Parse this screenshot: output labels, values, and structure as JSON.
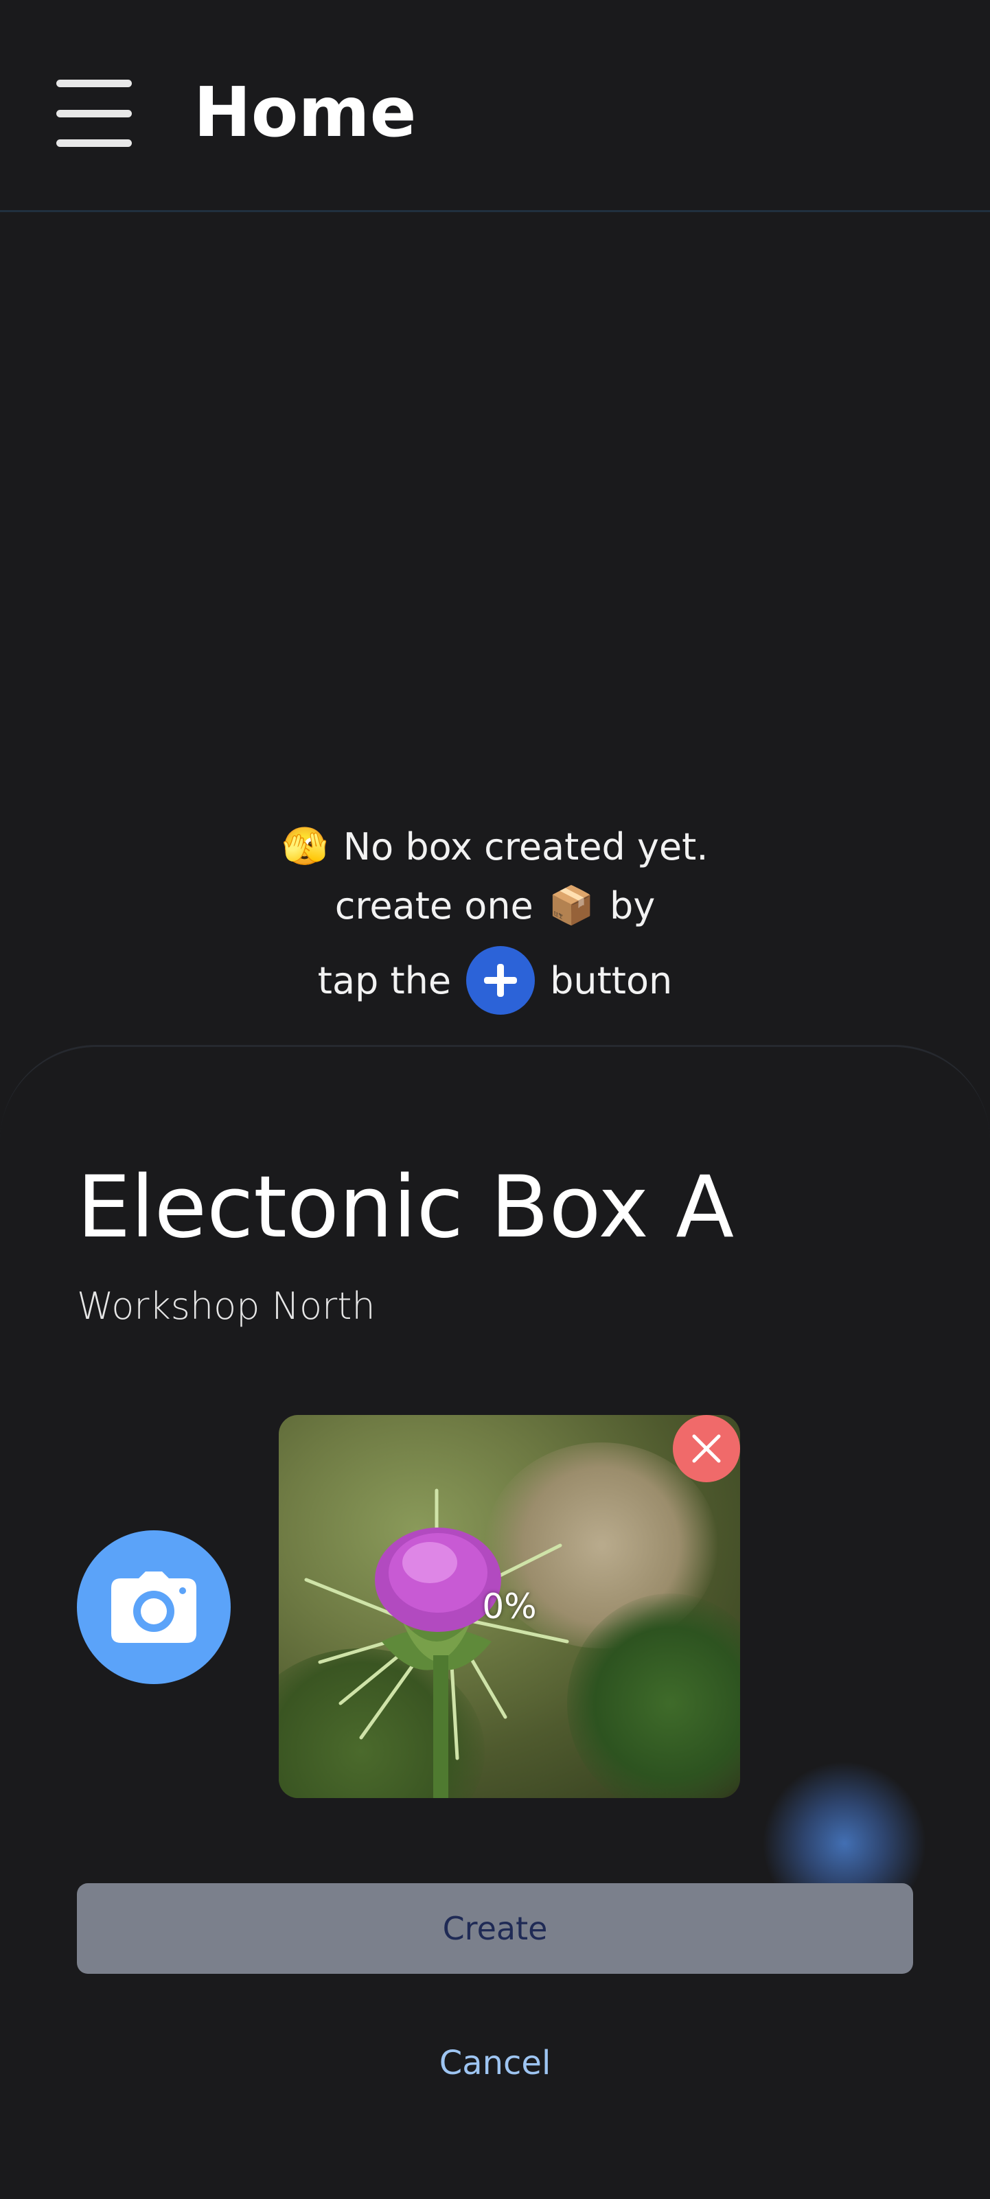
{
  "header": {
    "title": "Home",
    "menu_icon": "hamburger-menu-icon"
  },
  "empty_state": {
    "line1_emoji": "🫣",
    "line1_text": "No box created yet.",
    "line2_text_a": "create one",
    "line2_emoji": "📦",
    "line2_text_b": "by",
    "line3_text_a": "tap the",
    "line3_icon": "plus-icon",
    "line3_text_b": "button"
  },
  "sheet": {
    "box_name": "Electonic Box A",
    "location": "Workshop North",
    "camera_icon": "camera-icon",
    "photo": {
      "upload_progress": "0%",
      "remove_icon": "close-icon"
    },
    "create_label": "Create",
    "cancel_label": "Cancel"
  },
  "colors": {
    "background": "#1a1a1c",
    "plus_button": "#2c63d8",
    "camera_button": "#5ba3f9",
    "remove_button": "#f06a6a",
    "create_button_bg": "#7b808c",
    "create_button_text": "#1f2a55",
    "cancel_text": "#9ec5f2"
  }
}
